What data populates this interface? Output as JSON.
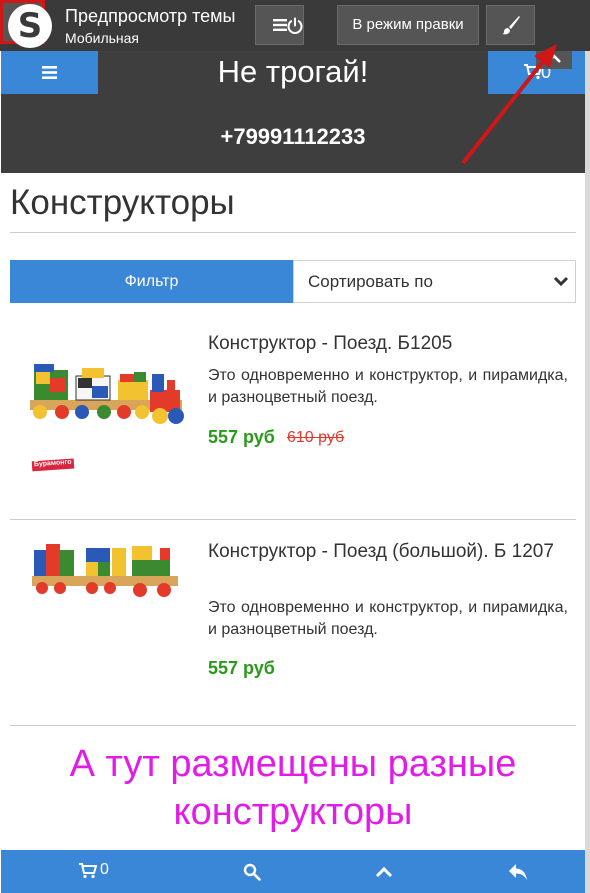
{
  "preview_bar": {
    "title": "Предпросмотр темы",
    "subtitle": "Мобильная",
    "logo_letter": "S",
    "menu_icon": "menu-icon",
    "edit_label": "В режим правки",
    "brush_icon": "brush-icon",
    "power_icon": "power-icon"
  },
  "header": {
    "menu_icon": "menu-icon",
    "title": "Не трогай!",
    "cart_count": "0",
    "phone": "+79991112233"
  },
  "page": {
    "title": "Конструкторы",
    "filter_label": "Фильтр",
    "sort_label": "Сортировать по"
  },
  "products": [
    {
      "name": "Конструктор - Поезд. Б1205",
      "description": "Это одновременно и конструктор, и пирамидка, и разноцветный поезд.",
      "price": "557 руб",
      "old_price": "610 руб",
      "brand_label": "Бурамонго"
    },
    {
      "name": "Конструктор - Поезд (большой). Б 1207",
      "description": "Это одновременно и конструктор, и пирамидка, и разноцветный поезд.",
      "price": "557 руб",
      "old_price": ""
    }
  ],
  "annotation": {
    "text_line1": "А тут размещены разные",
    "text_line2": "конструкторы",
    "color": "#e21ce8",
    "arrow_color": "#d01616"
  },
  "bottom_bar": {
    "cart_count": "0",
    "icons": [
      "cart-icon",
      "search-icon",
      "chevron-up-icon",
      "reply-icon"
    ]
  },
  "colors": {
    "accent": "#3a87d8",
    "dark": "#3e3e3e",
    "price": "#2a9a1a",
    "old_price": "#e03a2e"
  }
}
